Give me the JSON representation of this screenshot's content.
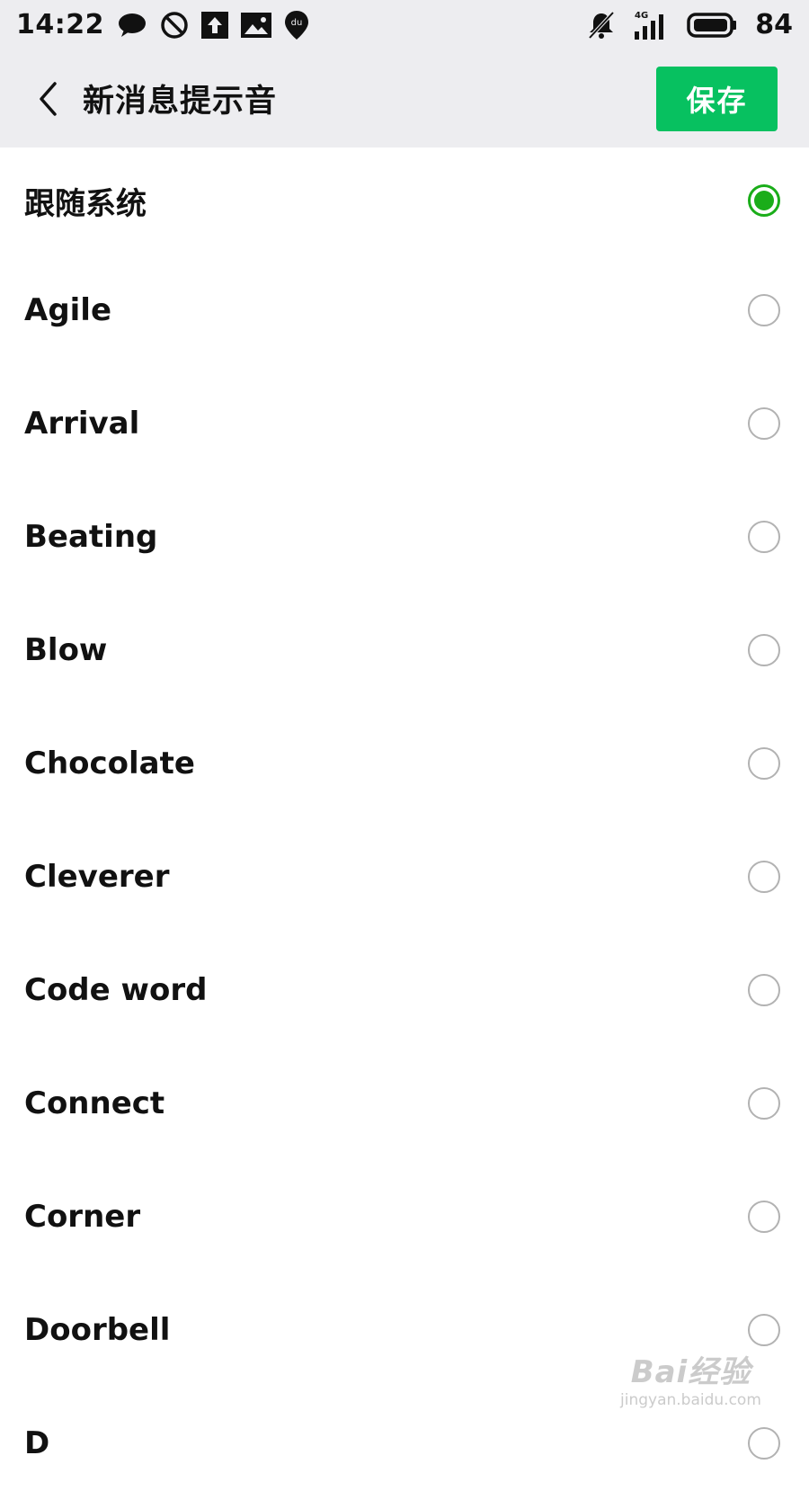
{
  "status_bar": {
    "time": "14:22",
    "battery": "84",
    "network": "4G",
    "left_icons": [
      "chat-bubble-icon",
      "blocked-icon",
      "upload-icon",
      "image-icon",
      "du-location-icon"
    ],
    "right_icons": [
      "mute-icon",
      "signal-icon",
      "battery-icon"
    ]
  },
  "nav": {
    "title": "新消息提示音",
    "save_label": "保存"
  },
  "colors": {
    "accent": "#07c160",
    "radio_checked": "#1aad19",
    "radio_unchecked": "#b2b2b2",
    "header_bg": "#ededf0"
  },
  "sounds": [
    {
      "label": "跟随系统",
      "selected": true
    },
    {
      "label": "Agile",
      "selected": false
    },
    {
      "label": "Arrival",
      "selected": false
    },
    {
      "label": "Beating",
      "selected": false
    },
    {
      "label": "Blow",
      "selected": false
    },
    {
      "label": "Chocolate",
      "selected": false
    },
    {
      "label": "Cleverer",
      "selected": false
    },
    {
      "label": "Code word",
      "selected": false
    },
    {
      "label": "Connect",
      "selected": false
    },
    {
      "label": "Corner",
      "selected": false
    },
    {
      "label": "Doorbell",
      "selected": false
    },
    {
      "label": "D",
      "selected": false
    }
  ],
  "watermark": {
    "brand": "Bai经验",
    "url": "jingyan.baidu.com"
  }
}
